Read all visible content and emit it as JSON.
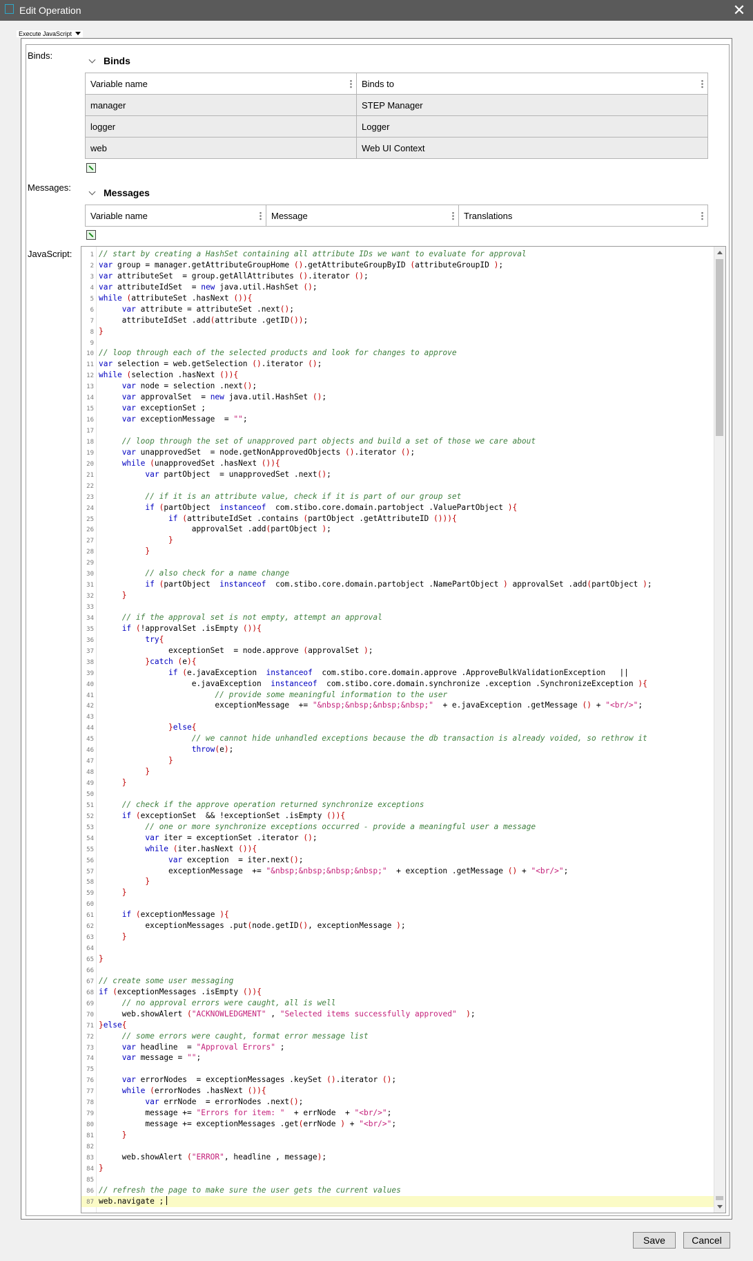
{
  "window": {
    "title": "Edit Operation"
  },
  "section": {
    "label": "Execute JavaScript"
  },
  "labels": {
    "binds": "Binds:",
    "messages": "Messages:",
    "javascript": "JavaScript:"
  },
  "binds": {
    "header": "Binds",
    "columns": [
      "Variable name",
      "Binds to"
    ],
    "rows": [
      [
        "manager",
        "STEP Manager"
      ],
      [
        "logger",
        "Logger"
      ],
      [
        "web",
        "Web UI Context"
      ]
    ]
  },
  "messages": {
    "header": "Messages",
    "columns": [
      "Variable name",
      "Message",
      "Translations"
    ]
  },
  "code": {
    "lines": [
      "// start by creating a HashSet containing all attribute IDs we want to evaluate for approval",
      "var group = manager.getAttributeGroupHome ().getAttributeGroupByID (attributeGroupID );",
      "var attributeSet  = group.getAllAttributes ().iterator ();",
      "var attributeIdSet  = new java.util.HashSet ();",
      "while (attributeSet .hasNext ()){",
      "     var attribute = attributeSet .next();",
      "     attributeIdSet .add(attribute .getID());",
      "}",
      "",
      "// loop through each of the selected products and look for changes to approve",
      "var selection = web.getSelection ().iterator ();",
      "while (selection .hasNext ()){",
      "     var node = selection .next();",
      "     var approvalSet  = new java.util.HashSet ();",
      "     var exceptionSet ;",
      "     var exceptionMessage  = \"\";",
      "",
      "     // loop through the set of unapproved part objects and build a set of those we care about",
      "     var unapprovedSet  = node.getNonApprovedObjects ().iterator ();",
      "     while (unapprovedSet .hasNext ()){",
      "          var partObject  = unapprovedSet .next();",
      "",
      "          // if it is an attribute value, check if it is part of our group set",
      "          if (partObject  instanceof  com.stibo.core.domain.partobject .ValuePartObject ){",
      "               if (attributeIdSet .contains (partObject .getAttributeID ())){",
      "                    approvalSet .add(partObject );",
      "               }",
      "          }",
      "",
      "          // also check for a name change",
      "          if (partObject  instanceof  com.stibo.core.domain.partobject .NamePartObject ) approvalSet .add(partObject );",
      "     }",
      "",
      "     // if the approval set is not empty, attempt an approval",
      "     if (!approvalSet .isEmpty ()){",
      "          try{",
      "               exceptionSet  = node.approve (approvalSet );",
      "          }catch (e){",
      "               if (e.javaException  instanceof  com.stibo.core.domain.approve .ApproveBulkValidationException   ||",
      "                    e.javaException  instanceof  com.stibo.core.domain.synchronize .exception .SynchronizeException ){",
      "                         // provide some meaningful information to the user",
      "                         exceptionMessage  += \"&nbsp;&nbsp;&nbsp;&nbsp;\"  + e.javaException .getMessage () + \"<br/>\";",
      "",
      "               }else{",
      "                    // we cannot hide unhandled exceptions because the db transaction is already voided, so rethrow it",
      "                    throw(e);",
      "               }",
      "          }",
      "     }",
      "",
      "     // check if the approve operation returned synchronize exceptions",
      "     if (exceptionSet  && !exceptionSet .isEmpty ()){",
      "          // one or more synchronize exceptions occurred - provide a meaningful user a message",
      "          var iter = exceptionSet .iterator ();",
      "          while (iter.hasNext ()){",
      "               var exception  = iter.next();",
      "               exceptionMessage  += \"&nbsp;&nbsp;&nbsp;&nbsp;\"  + exception .getMessage () + \"<br/>\";",
      "          }",
      "     }",
      "",
      "     if (exceptionMessage ){",
      "          exceptionMessages .put(node.getID(), exceptionMessage );",
      "     }",
      "",
      "}",
      "",
      "// create some user messaging",
      "if (exceptionMessages .isEmpty ()){",
      "     // no approval errors were caught, all is well",
      "     web.showAlert (\"ACKNOWLEDGMENT\" , \"Selected items successfully approved\"  );",
      "}else{",
      "     // some errors were caught, format error message list",
      "     var headline  = \"Approval Errors\" ;",
      "     var message = \"\";",
      "",
      "     var errorNodes  = exceptionMessages .keySet ().iterator ();",
      "     while (errorNodes .hasNext ()){",
      "          var errNode  = errorNodes .next();",
      "          message += \"Errors for item: \"  + errNode  + \"<br/>\";",
      "          message += exceptionMessages .get(errNode ) + \"<br/>\";",
      "     }",
      "",
      "     web.showAlert (\"ERROR\", headline , message);",
      "}",
      "",
      "// refresh the page to make sure the user gets the current values",
      "web.navigate ;"
    ]
  },
  "footer": {
    "save_label": "Save",
    "cancel_label": "Cancel"
  }
}
